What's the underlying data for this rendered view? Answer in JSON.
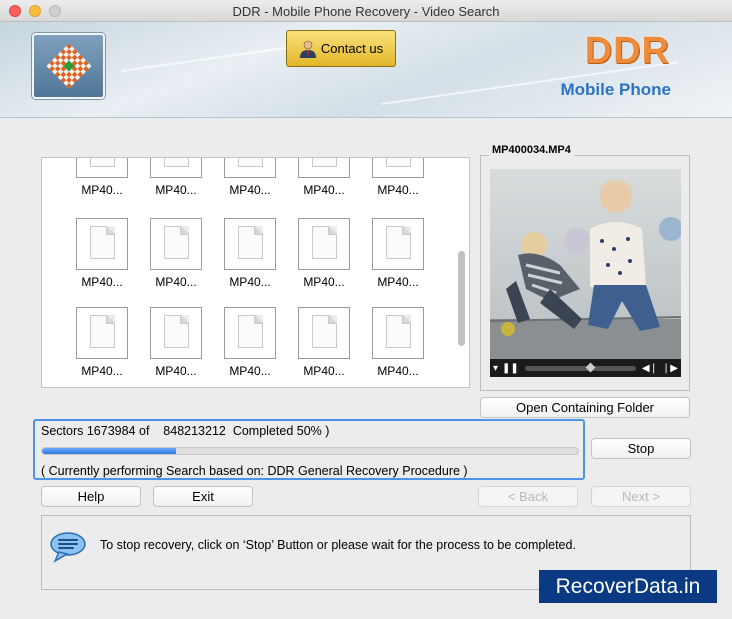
{
  "window": {
    "title": "DDR - Mobile Phone Recovery - Video Search"
  },
  "header": {
    "contact_label": "Contact us",
    "brand_title": "DDR",
    "brand_subtitle": "Mobile Phone",
    "brand_color": "#ef8c3b",
    "subtitle_color": "#2b73c4"
  },
  "files": {
    "items": [
      "MP40...",
      "MP40...",
      "MP40...",
      "MP40...",
      "MP40...",
      "MP40...",
      "MP40...",
      "MP40...",
      "MP40...",
      "MP40...",
      "MP40...",
      "MP40...",
      "MP40...",
      "MP40...",
      "MP40..."
    ]
  },
  "preview": {
    "filename": "MP400034.MP4",
    "open_folder_label": "Open Containing Folder",
    "control_icons": [
      "volume-icon",
      "pause-icon",
      "rewind-icon",
      "forward-icon"
    ]
  },
  "progress": {
    "sectors_line": "Sectors 1673984 of    848213212  Completed 50% )",
    "percent": 50,
    "procedure_line": "( Currently performing Search based on: DDR General Recovery Procedure )",
    "stop_label": "Stop"
  },
  "nav": {
    "help_label": "Help",
    "exit_label": "Exit",
    "back_label": "< Back",
    "next_label": "Next >"
  },
  "info": {
    "message": "To stop recovery, click on ‘Stop’ Button or please wait for the process to be completed."
  },
  "watermark": {
    "text": "RecoverData.in"
  },
  "colors": {
    "accent": "#4d93e9",
    "progress_fill": "#2d7be0",
    "watermark_bg": "#0a3a83"
  }
}
